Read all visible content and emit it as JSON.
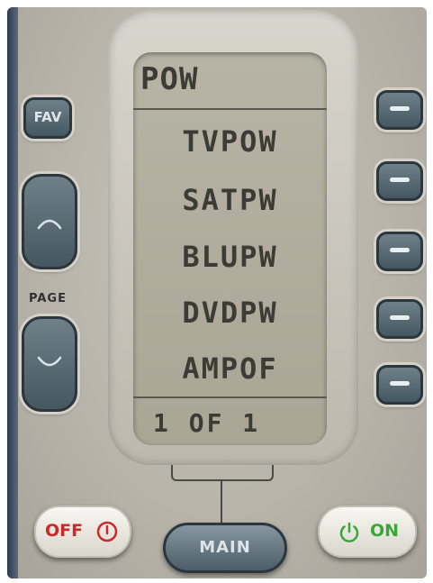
{
  "screen": {
    "header": "POW",
    "items": [
      "TVPOW",
      "SATPW",
      "BLUPW",
      "DVDPW",
      "AMPOF"
    ],
    "footer": "1 OF 1"
  },
  "buttons": {
    "fav_label": "FAV",
    "page_label": "PAGE",
    "main_label": "MAIN",
    "off_label": "OFF",
    "on_label": "ON"
  },
  "colors": {
    "off_accent": "#cc2a2a",
    "on_accent": "#39a63a",
    "lcd_background": "#b0ad9e"
  },
  "icons": [
    "chevron-up-icon",
    "chevron-down-icon",
    "dash-icon",
    "power-icon"
  ]
}
